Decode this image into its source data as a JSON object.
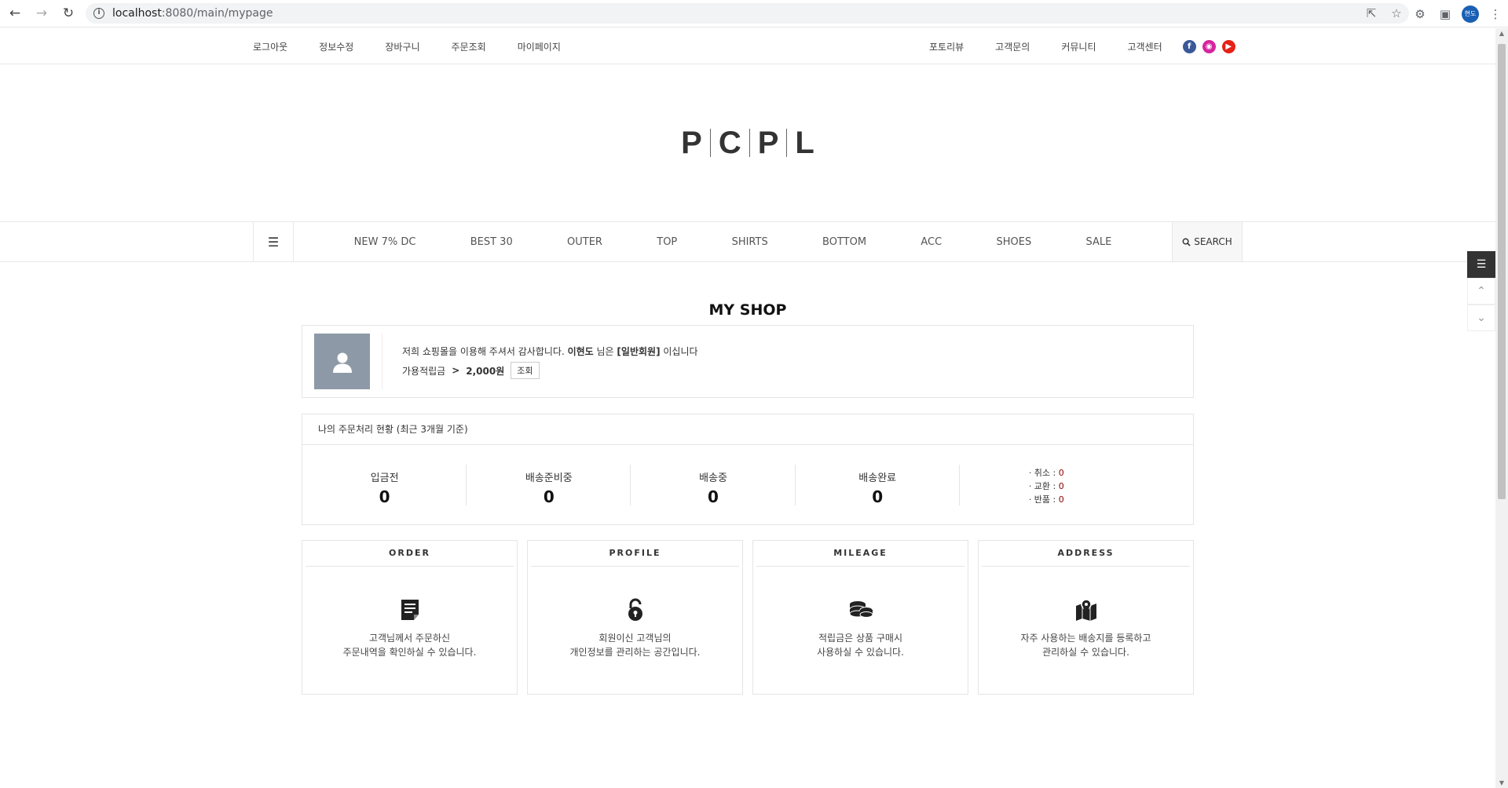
{
  "browser": {
    "url_host": "localhost",
    "url_rest": ":8080/main/mypage",
    "profile_initials": "현도"
  },
  "topbar": {
    "left_links": [
      "로그아웃",
      "정보수정",
      "장바구니",
      "주문조회",
      "마이페이지"
    ],
    "right_links": [
      "포토리뷰",
      "고객문의",
      "커뮤니티",
      "고객센터"
    ]
  },
  "logo": [
    "P",
    "C",
    "P",
    "L"
  ],
  "catnav": {
    "items": [
      "NEW 7% DC",
      "BEST 30",
      "OUTER",
      "TOP",
      "SHIRTS",
      "BOTTOM",
      "ACC",
      "SHOES",
      "SALE"
    ],
    "search_label": "SEARCH"
  },
  "page_title": "MY SHOP",
  "profile": {
    "greet_prefix": "저희 쇼핑몰을 이용해 주셔서 감사합니다. ",
    "user_name": "이현도",
    "greet_mid": " 님은 ",
    "grade": "[일반회원]",
    "greet_suffix": " 이십니다",
    "points_label": "가용적립금",
    "points_arrow": ">",
    "points_value": "2,000원",
    "points_button": "조회"
  },
  "order_status": {
    "header": "나의 주문처리 현황 (최근 3개월 기준)",
    "stats": [
      {
        "label": "입금전",
        "value": "0"
      },
      {
        "label": "배송준비중",
        "value": "0"
      },
      {
        "label": "배송중",
        "value": "0"
      },
      {
        "label": "배송완료",
        "value": "0"
      }
    ],
    "misc": [
      {
        "label": "· 취소 :",
        "value": "0"
      },
      {
        "label": "· 교환 :",
        "value": "0"
      },
      {
        "label": "· 반품 :",
        "value": "0"
      }
    ]
  },
  "cards": [
    {
      "title": "ORDER",
      "icon": "document-icon",
      "line1": "고객님께서 주문하신",
      "line2": "주문내역을 확인하실 수 있습니다."
    },
    {
      "title": "PROFILE",
      "icon": "lock-icon",
      "line1": "회원이신 고객님의",
      "line2": "개인정보를 관리하는 공간입니다."
    },
    {
      "title": "MILEAGE",
      "icon": "coins-icon",
      "line1": "적립금은 상품 구매시",
      "line2": "사용하실 수 있습니다."
    },
    {
      "title": "ADDRESS",
      "icon": "map-icon",
      "line1": "자주 사용하는 배송지를 등록하고",
      "line2": "관리하실 수 있습니다."
    }
  ]
}
